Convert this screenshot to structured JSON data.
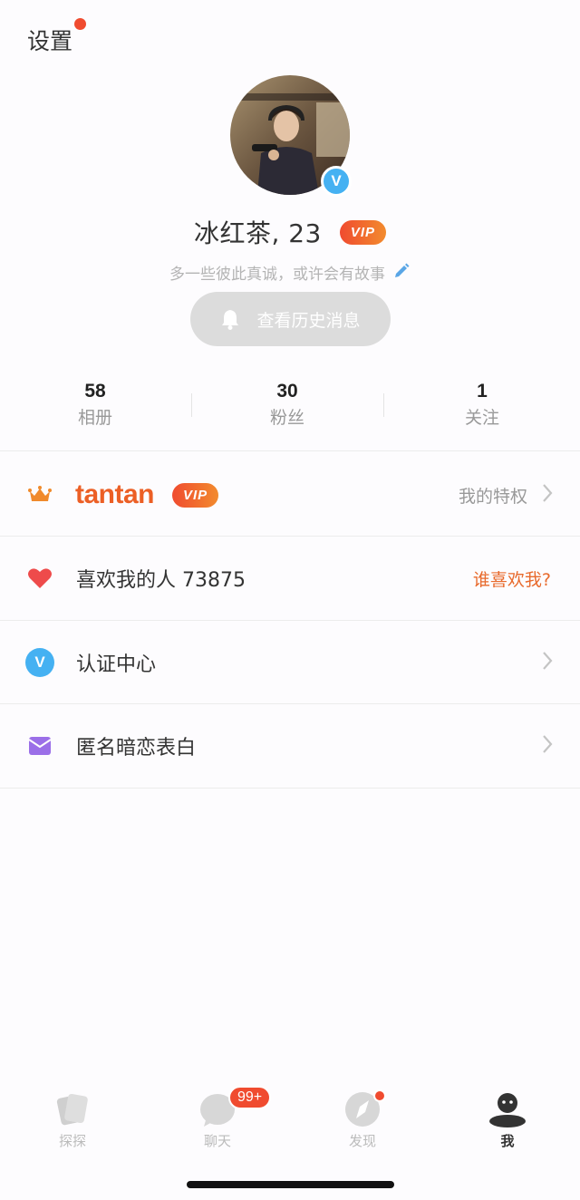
{
  "header": {
    "settings_label": "设置"
  },
  "profile": {
    "name": "冰红茶, 23",
    "vip_badge": "VIP",
    "verified_badge": "V",
    "bio": "多一些彼此真诚，或许会有故事",
    "history_button": "查看历史消息"
  },
  "stats": [
    {
      "value": "58",
      "label": "相册"
    },
    {
      "value": "30",
      "label": "粉丝"
    },
    {
      "value": "1",
      "label": "关注"
    }
  ],
  "menu": {
    "tantan_vip": {
      "brand": "tantan",
      "badge": "VIP",
      "right": "我的特权",
      "icon": "crown-icon"
    },
    "likes": {
      "label": "喜欢我的人 73875",
      "right": "谁喜欢我?",
      "icon": "heart-icon"
    },
    "certification": {
      "label": "认证中心",
      "icon_text": "V",
      "icon": "verified-icon"
    },
    "anonymous": {
      "label": "匿名暗恋表白",
      "icon": "envelope-icon"
    }
  },
  "tabs": [
    {
      "label": "探探",
      "icon": "cards-icon"
    },
    {
      "label": "聊天",
      "icon": "chat-icon",
      "badge": "99+"
    },
    {
      "label": "发现",
      "icon": "compass-icon"
    },
    {
      "label": "我",
      "icon": "profile-icon",
      "active": true
    }
  ],
  "colors": {
    "accent": "#f04b2f",
    "brand_orange": "#ec5f25",
    "verified_blue": "#45b1f2",
    "heart_red": "#ee4b4b",
    "envelope_purple": "#9b6fe8"
  }
}
